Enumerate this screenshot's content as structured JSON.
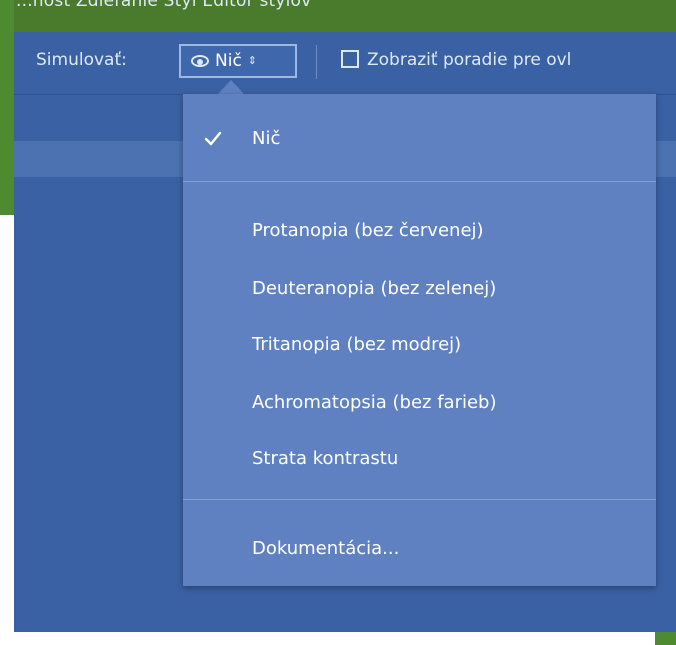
{
  "top_strip": {
    "text": "...nosť   Zdieľanie   Štýl   Editor štýlov"
  },
  "toolbar": {
    "simulate_label": "Simulovať:",
    "simulate_value": "Nič",
    "checkbox_label": "Zobraziť poradie pre ovl"
  },
  "dropdown": {
    "selected": "Nič",
    "items": [
      "Protanopia (bez červenej)",
      "Deuteranopia (bez zelenej)",
      "Tritanopia (bez modrej)",
      "Achromatopsia (bez farieb)",
      "Strata kontrastu"
    ],
    "footer_item": "Dokumentácia..."
  },
  "icons": {
    "check": "checkmark-icon",
    "eye": "eye-icon",
    "updown": "updown-icon"
  },
  "colors": {
    "panel": "#3b61a5",
    "dropdown": "#5f81c1",
    "background_green": "#4e8a2f"
  }
}
